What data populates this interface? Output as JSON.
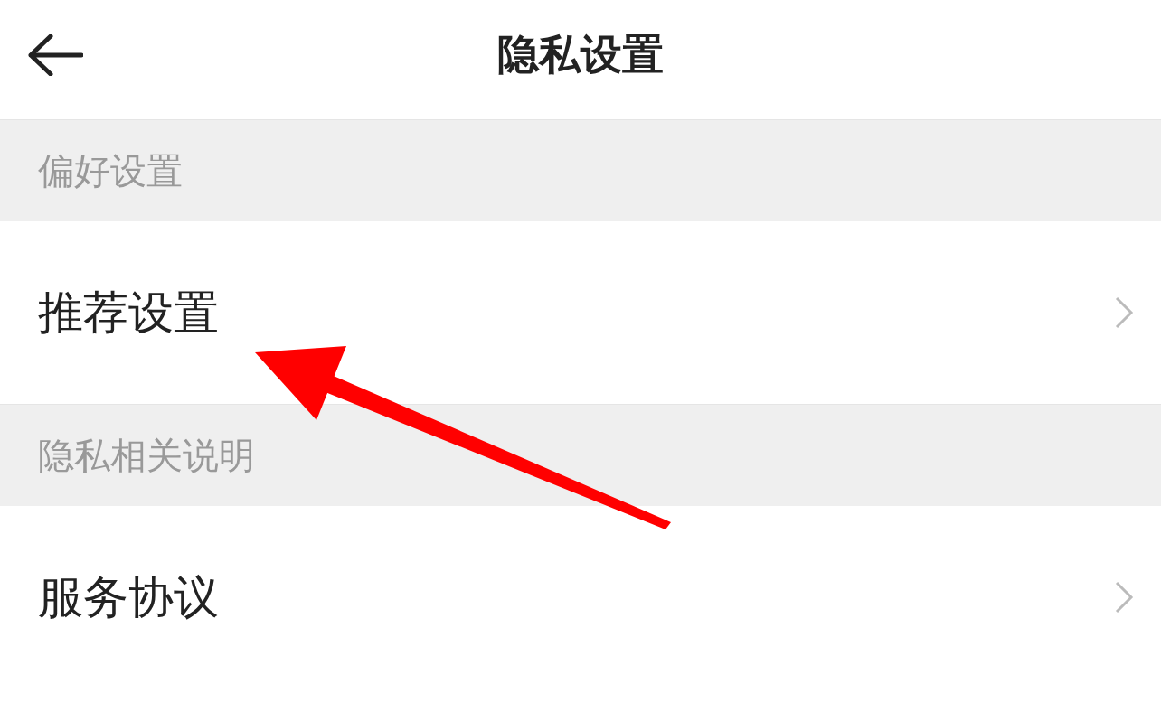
{
  "header": {
    "title": "隐私设置"
  },
  "sections": [
    {
      "title": "偏好设置",
      "items": [
        {
          "label": "推荐设置"
        }
      ]
    },
    {
      "title": "隐私相关说明",
      "items": [
        {
          "label": "服务协议"
        }
      ]
    }
  ]
}
